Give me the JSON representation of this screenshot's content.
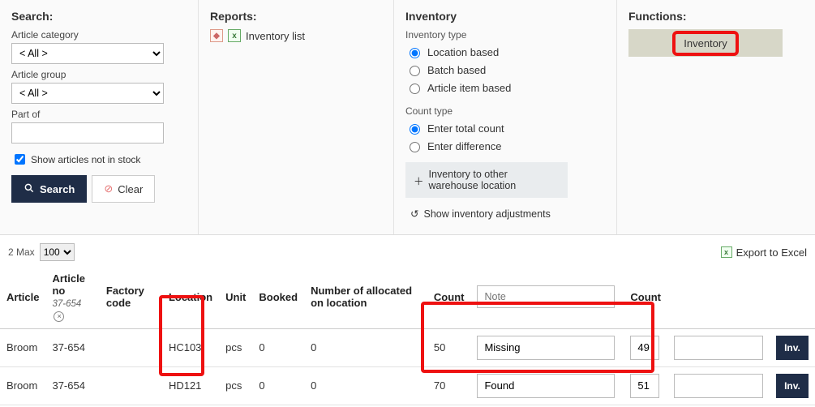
{
  "search": {
    "title": "Search:",
    "category_label": "Article category",
    "category_value": "< All >",
    "group_label": "Article group",
    "group_value": "< All >",
    "partof_label": "Part of",
    "partof_value": "",
    "show_not_in_stock": "Show articles not in stock",
    "search_btn": "Search",
    "clear_btn": "Clear"
  },
  "reports": {
    "title": "Reports:",
    "item": "Inventory list"
  },
  "inventory": {
    "title": "Inventory",
    "type_label": "Inventory type",
    "types": [
      "Location based",
      "Batch based",
      "Article item based"
    ],
    "type_selected": "Location based",
    "count_label": "Count type",
    "count_types": [
      "Enter total count",
      "Enter difference"
    ],
    "count_selected": "Enter total count",
    "link_move": "Inventory to other warehouse location",
    "link_adjust": "Show inventory adjustments"
  },
  "functions": {
    "title": "Functions:",
    "btn": "Inventory"
  },
  "meta": {
    "max_label": "2 Max",
    "pagesize": "100",
    "export": "Export to Excel"
  },
  "grid": {
    "headers": {
      "article": "Article",
      "article_no": "Article no",
      "article_no_sub": "37-654",
      "factory": "Factory code",
      "location": "Location",
      "unit": "Unit",
      "booked": "Booked",
      "allocated": "Number of allocated on location",
      "count1": "Count",
      "note_ph": "Note",
      "count2": "Count"
    },
    "rows": [
      {
        "article": "Broom",
        "article_no": "37-654",
        "factory": "",
        "location": "HC103",
        "unit": "pcs",
        "booked": "0",
        "allocated": "0",
        "count1": "50",
        "note": "Missing",
        "count2": "49",
        "btn": "Inv."
      },
      {
        "article": "Broom",
        "article_no": "37-654",
        "factory": "",
        "location": "HD121",
        "unit": "pcs",
        "booked": "0",
        "allocated": "0",
        "count1": "70",
        "note": "Found",
        "count2": "51",
        "btn": "Inv."
      }
    ]
  }
}
